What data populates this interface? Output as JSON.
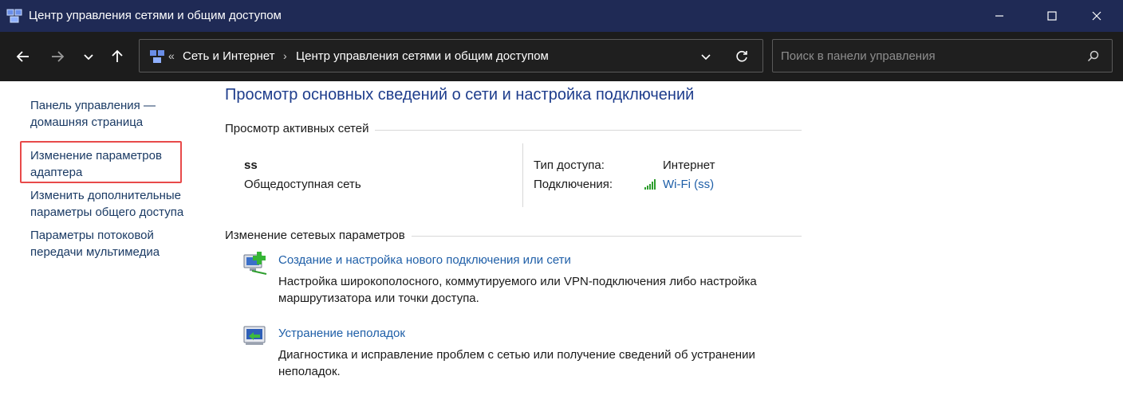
{
  "window": {
    "title": "Центр управления сетями и общим доступом"
  },
  "address_bar": {
    "prefix": "«",
    "crumbs": [
      "Сеть и Интернет",
      "Центр управления сетями и общим доступом"
    ],
    "separator": "›"
  },
  "search": {
    "placeholder": "Поиск в панели управления"
  },
  "sidebar": {
    "items": [
      {
        "line1": "Панель управления —",
        "line2": "домашняя страница"
      },
      {
        "line1": "Изменение параметров",
        "line2": "адаптера"
      },
      {
        "line1": "Изменить дополнительные",
        "line2": "параметры общего доступа"
      },
      {
        "line1": "Параметры потоковой",
        "line2": "передачи мультимедиа"
      }
    ]
  },
  "main": {
    "title": "Просмотр основных сведений о сети и настройка подключений",
    "active_networks": {
      "heading": "Просмотр активных сетей",
      "network_name": "ss",
      "network_type": "Общедоступная сеть",
      "access_label": "Тип доступа:",
      "access_value": "Интернет",
      "connections_label": "Подключения:",
      "connections_value": "Wi-Fi (ss)"
    },
    "change_settings": {
      "heading": "Изменение сетевых параметров",
      "tasks": [
        {
          "link": "Создание и настройка нового подключения или сети",
          "desc_line1": "Настройка широкополосного, коммутируемого или VPN-подключения либо настройка",
          "desc_line2": "маршрутизатора или точки доступа."
        },
        {
          "link": "Устранение неполадок",
          "desc_line1": "Диагностика и исправление проблем с сетью или получение сведений об устранении",
          "desc_line2": "неполадок."
        }
      ]
    }
  },
  "colors": {
    "titlebar": "#1f2a55",
    "toolbar": "#1c1c1c",
    "heading": "#1e3d8c",
    "link": "#1f5fa8",
    "highlight": "#e84a4a"
  }
}
